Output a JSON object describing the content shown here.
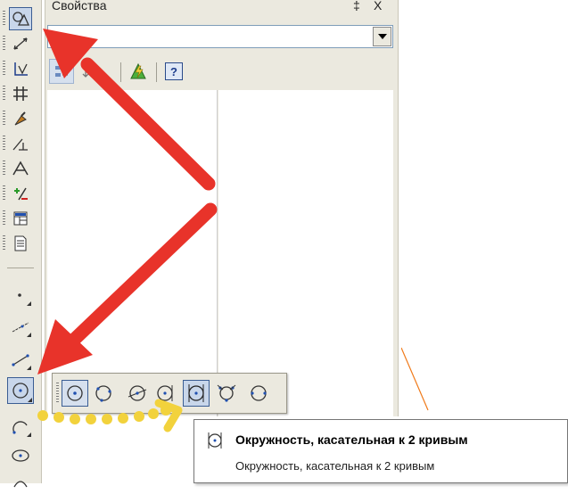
{
  "panel": {
    "title": "Свойства",
    "pin_glyph": "‡",
    "close_glyph": "X",
    "combo_value": "",
    "help_glyph": "?"
  },
  "toolbar": {
    "buttons": [
      {
        "icon": "geometry-icon"
      },
      {
        "icon": "dimensions-icon"
      },
      {
        "icon": "designations-icon"
      },
      {
        "icon": "edit-icon"
      },
      {
        "icon": "parametrization-icon"
      },
      {
        "icon": "measure-icon"
      },
      {
        "icon": "select-icon"
      },
      {
        "icon": "spec-icon"
      },
      {
        "icon": "report-icon"
      },
      {
        "icon": "insert-icon"
      },
      {
        "icon": "point-icon"
      },
      {
        "icon": "auxiliary-line-icon"
      },
      {
        "icon": "segment-icon"
      },
      {
        "icon": "circle-icon"
      },
      {
        "icon": "arc-icon"
      },
      {
        "icon": "ellipse-icon"
      }
    ]
  },
  "flyout": {
    "buttons": [
      {
        "icon": "circle-center-icon"
      },
      {
        "icon": "circle-3-points-icon"
      },
      {
        "icon": "circle-center-on-object-icon"
      },
      {
        "icon": "circle-tangent-1-curve-icon"
      },
      {
        "icon": "circle-tangent-2-curves-icon"
      },
      {
        "icon": "circle-tangent-3-curves-icon"
      },
      {
        "icon": "circle-2-points-icon"
      }
    ],
    "active_index": 4
  },
  "tooltip": {
    "title": "Окружность, касательная к 2 кривым",
    "description": "Окружность, касательная к 2 кривым"
  },
  "colors": {
    "arrow": "#e8332a",
    "dotted_arrow": "#f2d23c",
    "accent": "#3a5d93",
    "curve": "#f07a1a"
  }
}
